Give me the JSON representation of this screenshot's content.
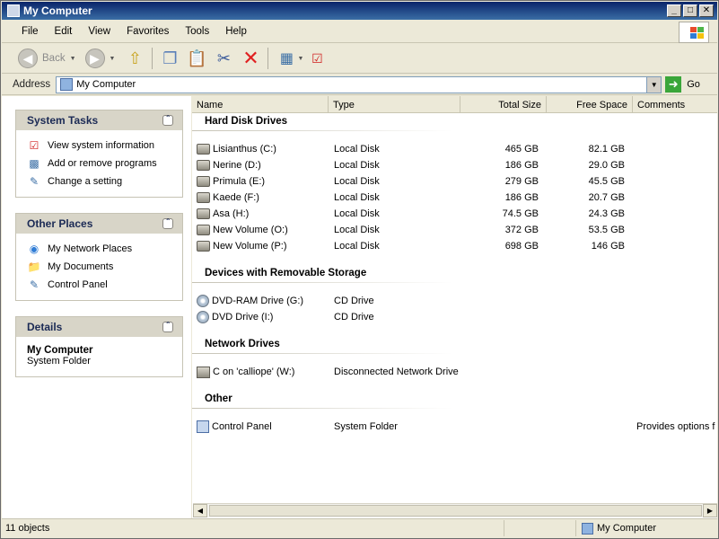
{
  "window": {
    "title": "My Computer"
  },
  "title_buttons": {
    "minimize": "_",
    "maximize": "□",
    "close": "✕"
  },
  "menu": [
    "File",
    "Edit",
    "View",
    "Favorites",
    "Tools",
    "Help"
  ],
  "toolbar": {
    "back_label": "Back"
  },
  "address": {
    "label": "Address",
    "value": "My Computer",
    "go_label": "Go"
  },
  "columns": [
    "Name",
    "Type",
    "Total Size",
    "Free Space",
    "Comments"
  ],
  "panels": {
    "system_tasks": {
      "title": "System Tasks",
      "items": [
        "View system information",
        "Add or remove programs",
        "Change a setting"
      ]
    },
    "other_places": {
      "title": "Other Places",
      "items": [
        "My Network Places",
        "My Documents",
        "Control Panel"
      ]
    },
    "details": {
      "title": "Details",
      "name": "My Computer",
      "type": "System Folder"
    }
  },
  "groups": {
    "hard_disks": {
      "title": "Hard Disk Drives",
      "rows": [
        {
          "name": "Lisianthus (C:)",
          "type": "Local Disk",
          "total": "465 GB",
          "free": "82.1 GB"
        },
        {
          "name": "Nerine (D:)",
          "type": "Local Disk",
          "total": "186 GB",
          "free": "29.0 GB"
        },
        {
          "name": "Primula (E:)",
          "type": "Local Disk",
          "total": "279 GB",
          "free": "45.5 GB"
        },
        {
          "name": "Kaede (F:)",
          "type": "Local Disk",
          "total": "186 GB",
          "free": "20.7 GB"
        },
        {
          "name": "Asa (H:)",
          "type": "Local Disk",
          "total": "74.5 GB",
          "free": "24.3 GB"
        },
        {
          "name": "New Volume (O:)",
          "type": "Local Disk",
          "total": "372 GB",
          "free": "53.5 GB"
        },
        {
          "name": "New Volume (P:)",
          "type": "Local Disk",
          "total": "698 GB",
          "free": "146 GB"
        }
      ]
    },
    "removable": {
      "title": "Devices with Removable Storage",
      "rows": [
        {
          "name": "DVD-RAM Drive (G:)",
          "type": "CD Drive"
        },
        {
          "name": "DVD Drive (I:)",
          "type": "CD Drive"
        }
      ]
    },
    "network": {
      "title": "Network Drives",
      "rows": [
        {
          "name": "C on 'calliope' (W:)",
          "type": "Disconnected Network Drive"
        }
      ]
    },
    "other": {
      "title": "Other",
      "rows": [
        {
          "name": "Control Panel",
          "type": "System Folder",
          "comments": "Provides options f"
        }
      ]
    }
  },
  "status": {
    "count": "11 objects",
    "location": "My Computer"
  },
  "colors": {
    "title_start": "#0a246a",
    "title_end": "#3a6ea5",
    "chrome": "#ece9d8",
    "delete_red": "#e02020",
    "go_green": "#3aa63a"
  },
  "icons": [
    "back-icon",
    "forward-icon",
    "up-folder-icon",
    "copy-icon",
    "paste-icon",
    "cut-icon",
    "delete-icon",
    "views-icon",
    "properties-icon"
  ]
}
